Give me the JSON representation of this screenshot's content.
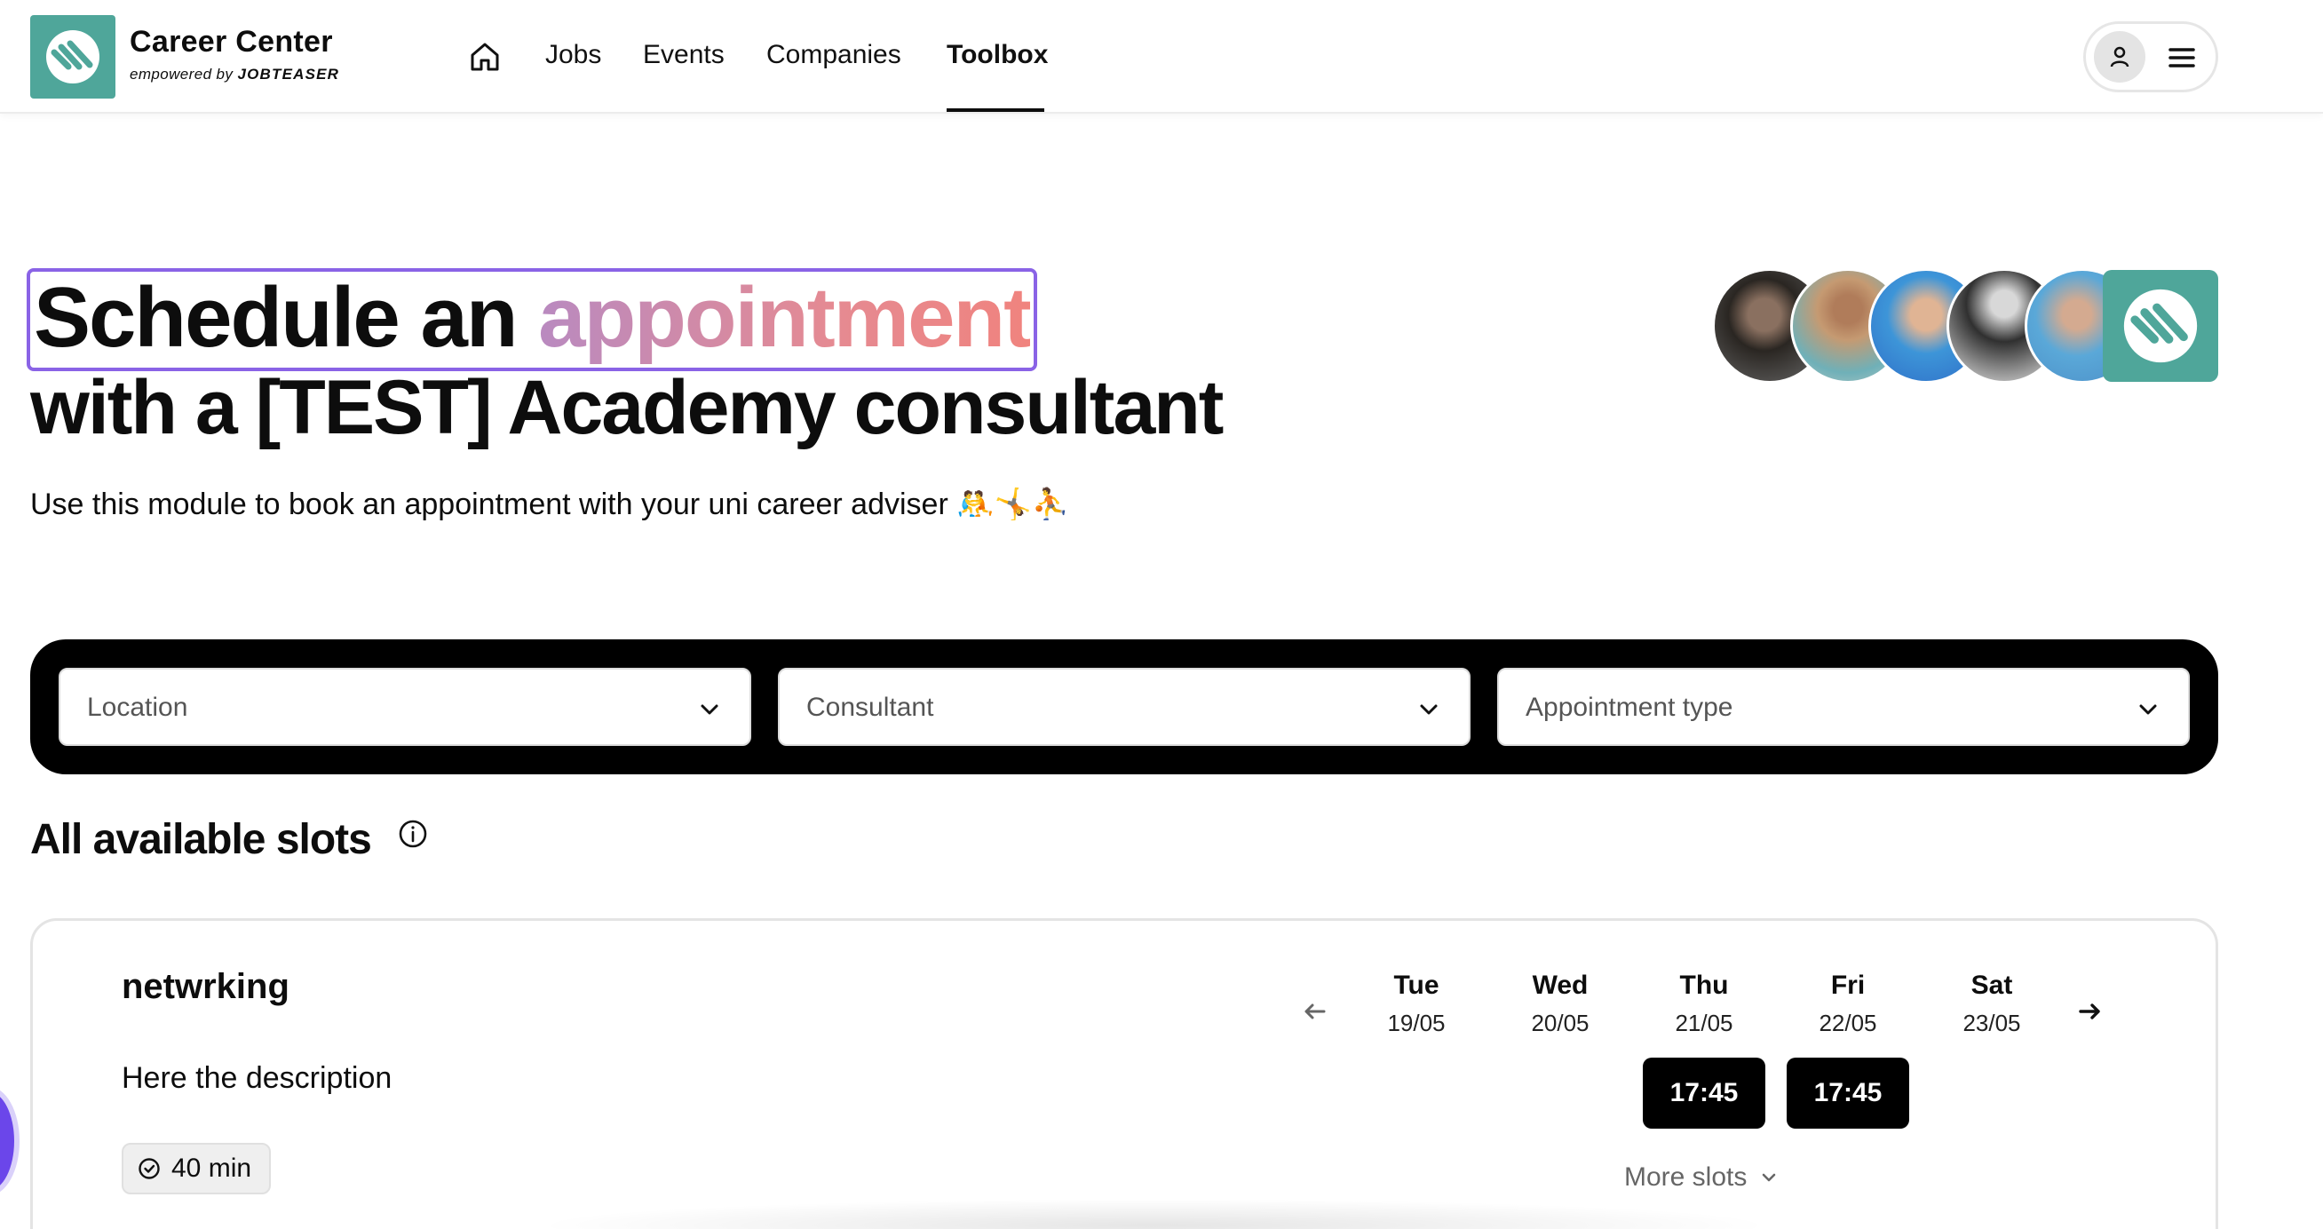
{
  "brand": {
    "name": "Career Center",
    "sub_prefix": "empowered by",
    "sub_brand": "JOBTEASER",
    "color": "#4fa69a"
  },
  "nav": {
    "home_icon": "home-icon",
    "items": [
      {
        "label": "Jobs"
      },
      {
        "label": "Events"
      },
      {
        "label": "Companies"
      },
      {
        "label": "Toolbox",
        "active": true
      }
    ]
  },
  "hero": {
    "title_part1": "Schedule an",
    "title_highlight": "appointment",
    "title_line2": "with a [TEST] Academy consultant",
    "description": "Use this module to book an appointment with your uni career adviser 🤼🤸⛹",
    "accent_color": "#8a63e6"
  },
  "filters": {
    "location_placeholder": "Location",
    "consultant_placeholder": "Consultant",
    "appointment_type_placeholder": "Appointment type"
  },
  "slots": {
    "title": "All available slots",
    "card": {
      "title": "netwrking",
      "description": "Here the description",
      "duration": "40 min",
      "days": [
        {
          "name": "Tue",
          "date": "19/05"
        },
        {
          "name": "Wed",
          "date": "20/05"
        },
        {
          "name": "Thu",
          "date": "21/05",
          "slot": "17:45"
        },
        {
          "name": "Fri",
          "date": "22/05",
          "slot": "17:45"
        },
        {
          "name": "Sat",
          "date": "23/05"
        }
      ],
      "more_slots": "More slots"
    }
  }
}
